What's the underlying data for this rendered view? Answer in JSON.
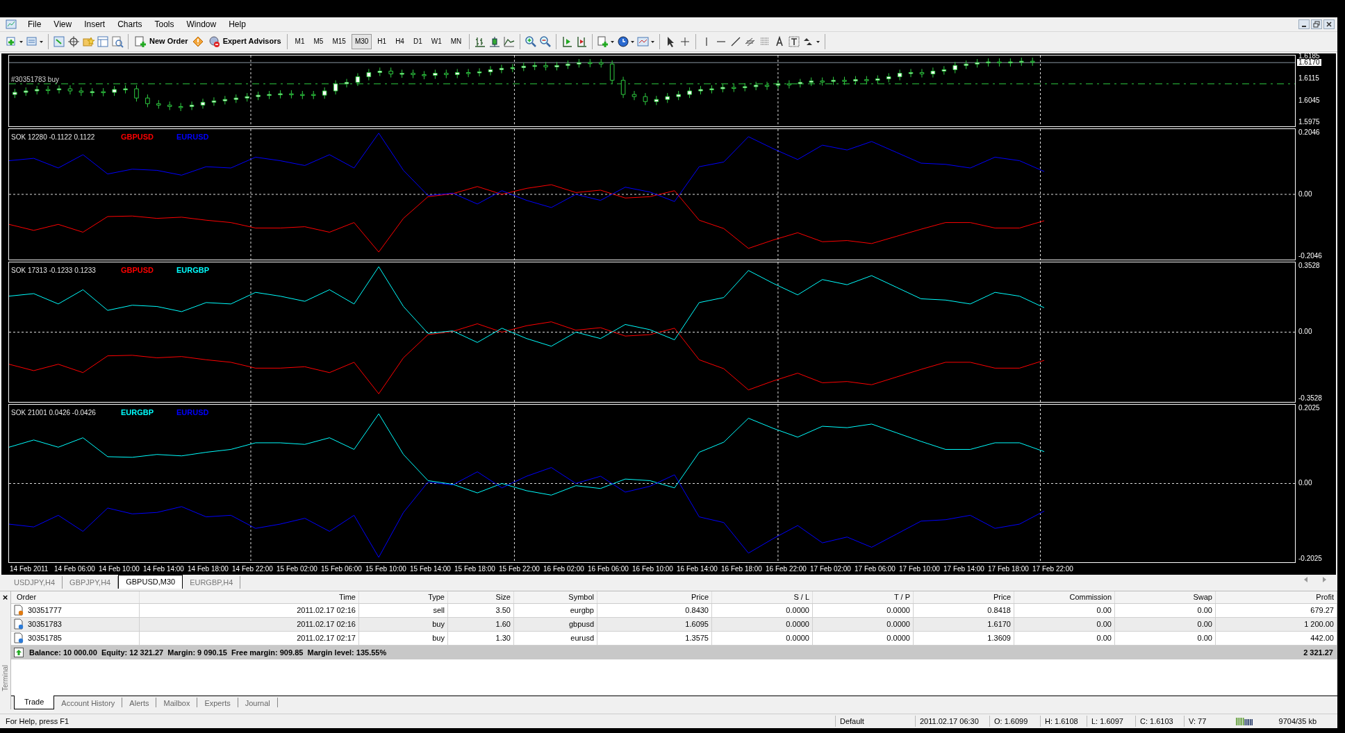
{
  "menu": [
    "File",
    "View",
    "Insert",
    "Charts",
    "Tools",
    "Window",
    "Help"
  ],
  "toolbar": {
    "new_order": "New Order",
    "expert_advisors": "Expert Advisors",
    "timeframes": [
      {
        "label": "M1",
        "selected": false
      },
      {
        "label": "M5",
        "selected": false
      },
      {
        "label": "M15",
        "selected": false
      },
      {
        "label": "M30",
        "selected": true
      },
      {
        "label": "H1",
        "selected": false
      },
      {
        "label": "H4",
        "selected": false
      },
      {
        "label": "D1",
        "selected": false
      },
      {
        "label": "W1",
        "selected": false
      },
      {
        "label": "MN",
        "selected": false
      }
    ]
  },
  "chart": {
    "trade_label": "#30351783 buy",
    "price_axis": [
      "1.6185",
      "1.6115",
      "1.6045",
      "1.5975"
    ],
    "current_price": "1.6170",
    "panes": [
      {
        "legend": "SOK 12280 -0.1122 0.1122",
        "symbols": [
          {
            "label": "GBPUSD",
            "color": "#ff0000"
          },
          {
            "label": "EURUSD",
            "color": "#0000ff"
          }
        ],
        "axis": [
          "0.2046",
          "0.00",
          "-0.2046"
        ]
      },
      {
        "legend": "SOK 17313 -0.1233 0.1233",
        "symbols": [
          {
            "label": "GBPUSD",
            "color": "#ff0000"
          },
          {
            "label": "EURGBP",
            "color": "#00ffff"
          }
        ],
        "axis": [
          "0.3528",
          "0.00",
          "-0.3528"
        ]
      },
      {
        "legend": "SOK 21001 0.0426 -0.0426",
        "symbols": [
          {
            "label": "EURGBP",
            "color": "#00ffff"
          },
          {
            "label": "EURUSD",
            "color": "#0000ff"
          }
        ],
        "axis": [
          "0.2025",
          "0.00",
          "-0.2025"
        ]
      }
    ],
    "time_axis": [
      "14 Feb 2011",
      "14 Feb 06:00",
      "14 Feb 10:00",
      "14 Feb 14:00",
      "14 Feb 18:00",
      "14 Feb 22:00",
      "15 Feb 02:00",
      "15 Feb 06:00",
      "15 Feb 10:00",
      "15 Feb 14:00",
      "15 Feb 18:00",
      "15 Feb 22:00",
      "16 Feb 02:00",
      "16 Feb 06:00",
      "16 Feb 10:00",
      "16 Feb 14:00",
      "16 Feb 18:00",
      "16 Feb 22:00",
      "17 Feb 02:00",
      "17 Feb 06:00",
      "17 Feb 10:00",
      "17 Feb 14:00",
      "17 Feb 18:00",
      "17 Feb 22:00"
    ]
  },
  "chart_tabs": [
    {
      "label": "USDJPY,H4",
      "selected": false
    },
    {
      "label": "GBPJPY,H4",
      "selected": false
    },
    {
      "label": "GBPUSD,M30",
      "selected": true
    },
    {
      "label": "EURGBP,H4",
      "selected": false
    }
  ],
  "terminal": {
    "close": "×",
    "side_label": "Terminal",
    "columns": [
      "Order",
      "Time",
      "Type",
      "Size",
      "Symbol",
      "Price",
      "S / L",
      "T / P",
      "Price",
      "Commission",
      "Swap",
      "Profit"
    ],
    "rows": [
      {
        "kind": "sell",
        "cells": [
          "30351777",
          "2011.02.17 02:16",
          "sell",
          "3.50",
          "eurgbp",
          "0.8430",
          "0.0000",
          "0.0000",
          "0.8418",
          "0.00",
          "0.00",
          "679.27"
        ]
      },
      {
        "kind": "buy",
        "cells": [
          "30351783",
          "2011.02.17 02:16",
          "buy",
          "1.60",
          "gbpusd",
          "1.6095",
          "0.0000",
          "0.0000",
          "1.6170",
          "0.00",
          "0.00",
          "1 200.00"
        ]
      },
      {
        "kind": "buy",
        "cells": [
          "30351785",
          "2011.02.17 02:17",
          "buy",
          "1.30",
          "eurusd",
          "1.3575",
          "0.0000",
          "0.0000",
          "1.3609",
          "0.00",
          "0.00",
          "442.00"
        ]
      }
    ],
    "summary": "Balance: 10 000.00  Equity: 12 321.27  Margin: 9 090.15  Free margin: 909.85  Margin level: 135.55%",
    "summary_profit": "2 321.27",
    "tabs": [
      {
        "label": "Trade",
        "selected": true
      },
      {
        "label": "Account History",
        "selected": false
      },
      {
        "label": "Alerts",
        "selected": false
      },
      {
        "label": "Mailbox",
        "selected": false
      },
      {
        "label": "Experts",
        "selected": false
      },
      {
        "label": "Journal",
        "selected": false
      }
    ]
  },
  "status_bar": {
    "help": "For Help, press F1",
    "fields": [
      "Default",
      "2011.02.17 06:30",
      "O: 1.6099",
      "H: 1.6108",
      "L: 1.6097",
      "C: 1.6103",
      "V: 77"
    ],
    "traffic": "9704/35 kb"
  }
}
